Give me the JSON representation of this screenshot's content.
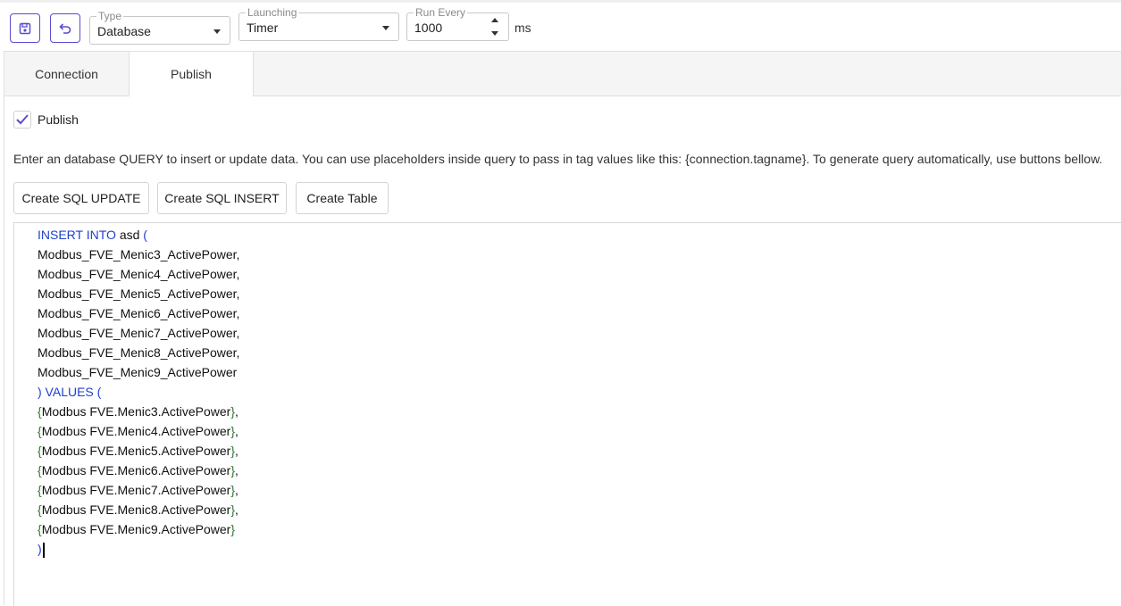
{
  "toolbar": {
    "save_icon": "save-icon",
    "undo_icon": "undo-icon",
    "type": {
      "label": "Type",
      "value": "Database"
    },
    "launching": {
      "label": "Launching",
      "value": "Timer"
    },
    "run_every": {
      "label": "Run Every",
      "value": "1000",
      "unit": "ms"
    }
  },
  "tabs": [
    {
      "label": "Connection",
      "active": false
    },
    {
      "label": "Publish",
      "active": true
    }
  ],
  "publish": {
    "checkbox_label": "Publish",
    "checked": true,
    "description": "Enter an database QUERY to insert or update data. You can use placeholders inside query to pass in tag values like this: {connection.tagname}. To generate query automatically, use buttons bellow.",
    "buttons": [
      "Create SQL UPDATE",
      "Create SQL INSERT",
      "Create Table"
    ]
  },
  "editor": {
    "keyword_insert": "INSERT INTO",
    "table_name": "asd",
    "open_paren": "(",
    "columns": [
      "Modbus_FVE_Menic3_ActivePower,",
      "Modbus_FVE_Menic4_ActivePower,",
      "Modbus_FVE_Menic5_ActivePower,",
      "Modbus_FVE_Menic6_ActivePower,",
      "Modbus_FVE_Menic7_ActivePower,",
      "Modbus_FVE_Menic8_ActivePower,",
      "Modbus_FVE_Menic9_ActivePower"
    ],
    "values_line": ") VALUES (",
    "values": [
      {
        "tag": "Modbus FVE.Menic3.ActivePower",
        "suffix": ","
      },
      {
        "tag": "Modbus FVE.Menic4.ActivePower",
        "suffix": ","
      },
      {
        "tag": "Modbus FVE.Menic5.ActivePower",
        "suffix": ","
      },
      {
        "tag": "Modbus FVE.Menic6.ActivePower",
        "suffix": ","
      },
      {
        "tag": "Modbus FVE.Menic7.ActivePower",
        "suffix": ","
      },
      {
        "tag": "Modbus FVE.Menic8.ActivePower",
        "suffix": ","
      },
      {
        "tag": "Modbus FVE.Menic9.ActivePower",
        "suffix": ""
      }
    ],
    "close_paren": ")"
  },
  "colors": {
    "accent": "#5a4ccf",
    "keyword": "#1f3fd0",
    "brace": "#2f7a2f"
  }
}
